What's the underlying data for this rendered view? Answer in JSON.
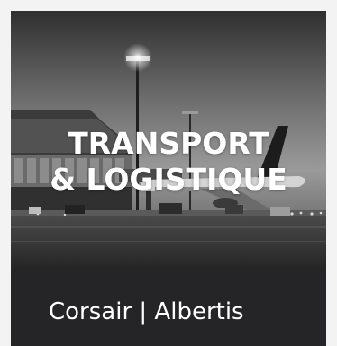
{
  "card": {
    "headline_line1": "TRANSPORT",
    "headline_line2": "& LOGISTIQUE",
    "client": "Corsair | Albertis"
  },
  "colors": {
    "page_background": "#f3f3f3",
    "footer_background": "#252426",
    "text": "#ffffff"
  },
  "image": {
    "subject": "airport-apron-photo",
    "style": "grayscale"
  }
}
